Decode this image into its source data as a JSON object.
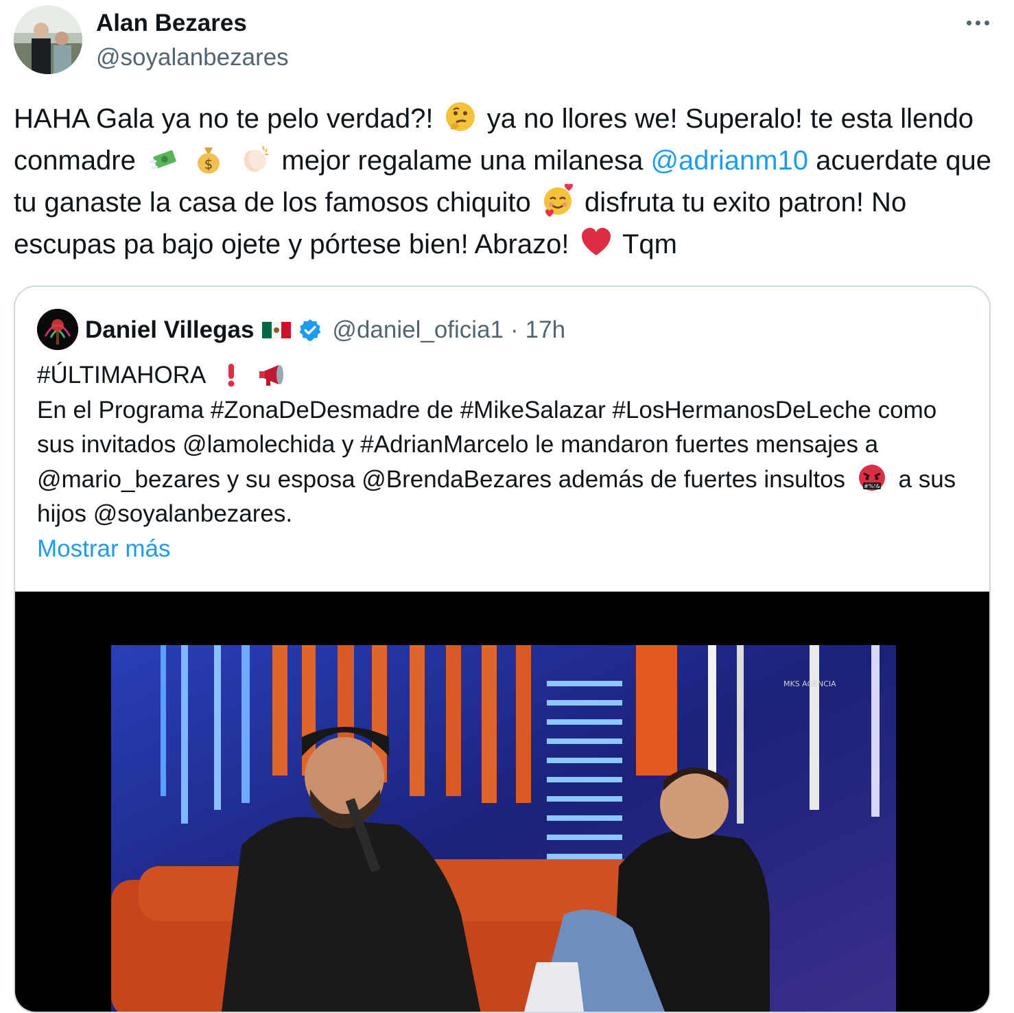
{
  "author": {
    "name": "Alan Bezares",
    "handle": "@soyalanbezares",
    "avatar_icon": "profile-photo"
  },
  "more_icon": "more-horizontal-icon",
  "tweet": {
    "seg1": "HAHA Gala ya no te pelo verdad?!",
    "emoji1": "thinking-face-emoji",
    "seg2": "ya no llores we! Superalo! te esta llendo conmadre",
    "emoji2": "money-with-wings-emoji",
    "emoji3": "money-bag-emoji",
    "emoji4": "clapping-hands-emoji",
    "seg3": "mejor regalame una milanesa",
    "mention": "@adrianm10",
    "seg4": "acuerdate que tu ganaste la casa de los famosos chiquito",
    "emoji5": "smiling-face-with-hearts-emoji",
    "seg5": "disfruta tu exito patron! No escupas pa bajo ojete y pórtese bien! Abrazo!",
    "emoji6": "red-heart-emoji",
    "seg6": "Tqm"
  },
  "quote": {
    "name": "Daniel Villegas",
    "flag_icon": "mexico-flag-emoji",
    "verified_icon": "verified-badge-icon",
    "handle": "@daniel_oficia1",
    "separator": "·",
    "time": "17h",
    "line1": "#ÚLTIMAHORA",
    "emoji_exclamation": "red-exclamation-emoji",
    "emoji_megaphone": "megaphone-emoji",
    "body": "En el Programa #ZonaDeDesmadre de #MikeSalazar #LosHermanosDeLeche como sus invitados @lamolechida y #AdrianMarcelo le mandaron fuertes mensajes a @mario_bezares y su esposa @BrendaBezares además de fuertes insultos",
    "emoji_angry": "face-with-symbols-on-mouth-emoji",
    "body_end": "a sus hijos @soyalanbezares.",
    "show_more": "Mostrar más",
    "video_watermark": "MKS AGENCIA"
  },
  "colors": {
    "accent": "#1d9bf0",
    "text": "#0f1419",
    "secondary": "#536471",
    "border": "#cfd9de"
  }
}
